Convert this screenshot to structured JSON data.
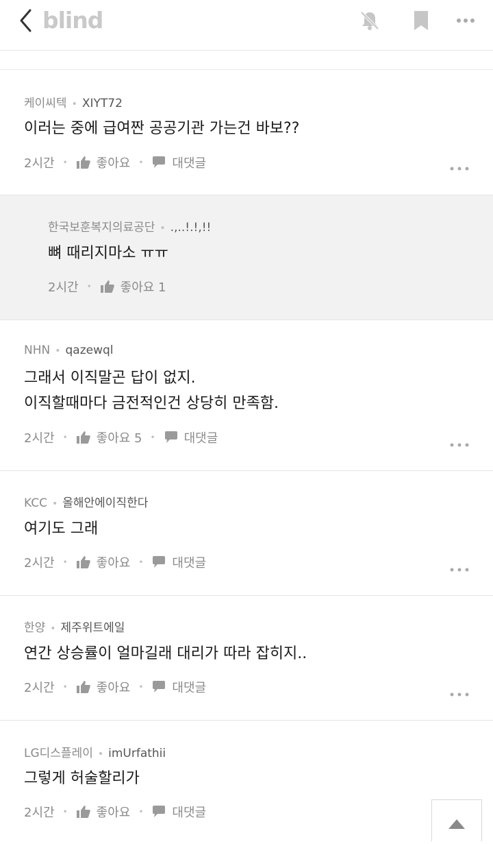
{
  "app": {
    "logo": "blind"
  },
  "icons": {
    "back": "chevron-left-icon",
    "bell": "bell-off-icon",
    "bookmark": "bookmark-icon",
    "more": "more-horizontal-icon",
    "scroll": "triangle-up-icon"
  },
  "comments": [
    {
      "company": "케이씨텍",
      "nickname": "XIYT72",
      "text": "이러는 중에 급여짠 공공기관 가는건 바보??",
      "time": "2시간",
      "like": "좋아요",
      "reply": "대댓글"
    },
    {
      "company": "한국보훈복지의료공단",
      "nickname": ".,..!.!,!!",
      "text": "뼈 때리지마소 ㅠㅠ",
      "time": "2시간",
      "like": "좋아요 1"
    },
    {
      "company": "NHN",
      "nickname": "qazewql",
      "text_line1": "그래서 이직말곤 답이 없지.",
      "text_line2": "이직할때마다 금전적인건 상당히 만족함.",
      "time": "2시간",
      "like": "좋아요 5",
      "reply": "대댓글"
    },
    {
      "company": "KCC",
      "nickname": "올해안에이직한다",
      "text": "여기도 그래",
      "time": "2시간",
      "like": "좋아요",
      "reply": "대댓글"
    },
    {
      "company": "한양",
      "nickname": "제주위트에일",
      "text": "연간 상승률이 얼마길래 대리가 따라 잡히지..",
      "time": "2시간",
      "like": "좋아요",
      "reply": "대댓글"
    },
    {
      "company": "LG디스플레이",
      "nickname": "imUrfathii",
      "text": "그렇게 허술할리가",
      "time": "2시간",
      "like": "좋아요",
      "reply": "대댓글"
    }
  ]
}
